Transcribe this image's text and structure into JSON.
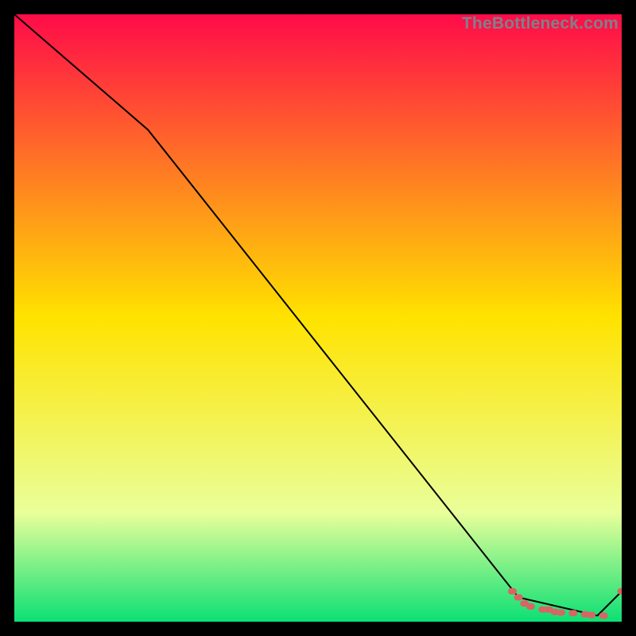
{
  "watermark": "TheBottleneck.com",
  "colors": {
    "grad_top": "#ff0b49",
    "grad_mid": "#ffe300",
    "grad_low": "#eaff9a",
    "grad_bottom": "#0be074",
    "line": "#000000",
    "marker": "#d76565"
  },
  "chart_data": {
    "type": "line",
    "title": "",
    "xlabel": "",
    "ylabel": "",
    "xlim": [
      0,
      100
    ],
    "ylim": [
      0,
      100
    ],
    "series": [
      {
        "name": "curve",
        "x": [
          0,
          22,
          83,
          96,
          100
        ],
        "y": [
          100,
          81,
          4,
          1,
          5
        ]
      }
    ],
    "markers": {
      "name": "highlight-points",
      "x": [
        82,
        83,
        84,
        85,
        87,
        88,
        89,
        90,
        92,
        94,
        95,
        97,
        100
      ],
      "y": [
        5,
        4,
        3,
        2.5,
        2,
        2,
        1.6,
        1.5,
        1.4,
        1.2,
        1.1,
        1,
        5
      ]
    }
  }
}
